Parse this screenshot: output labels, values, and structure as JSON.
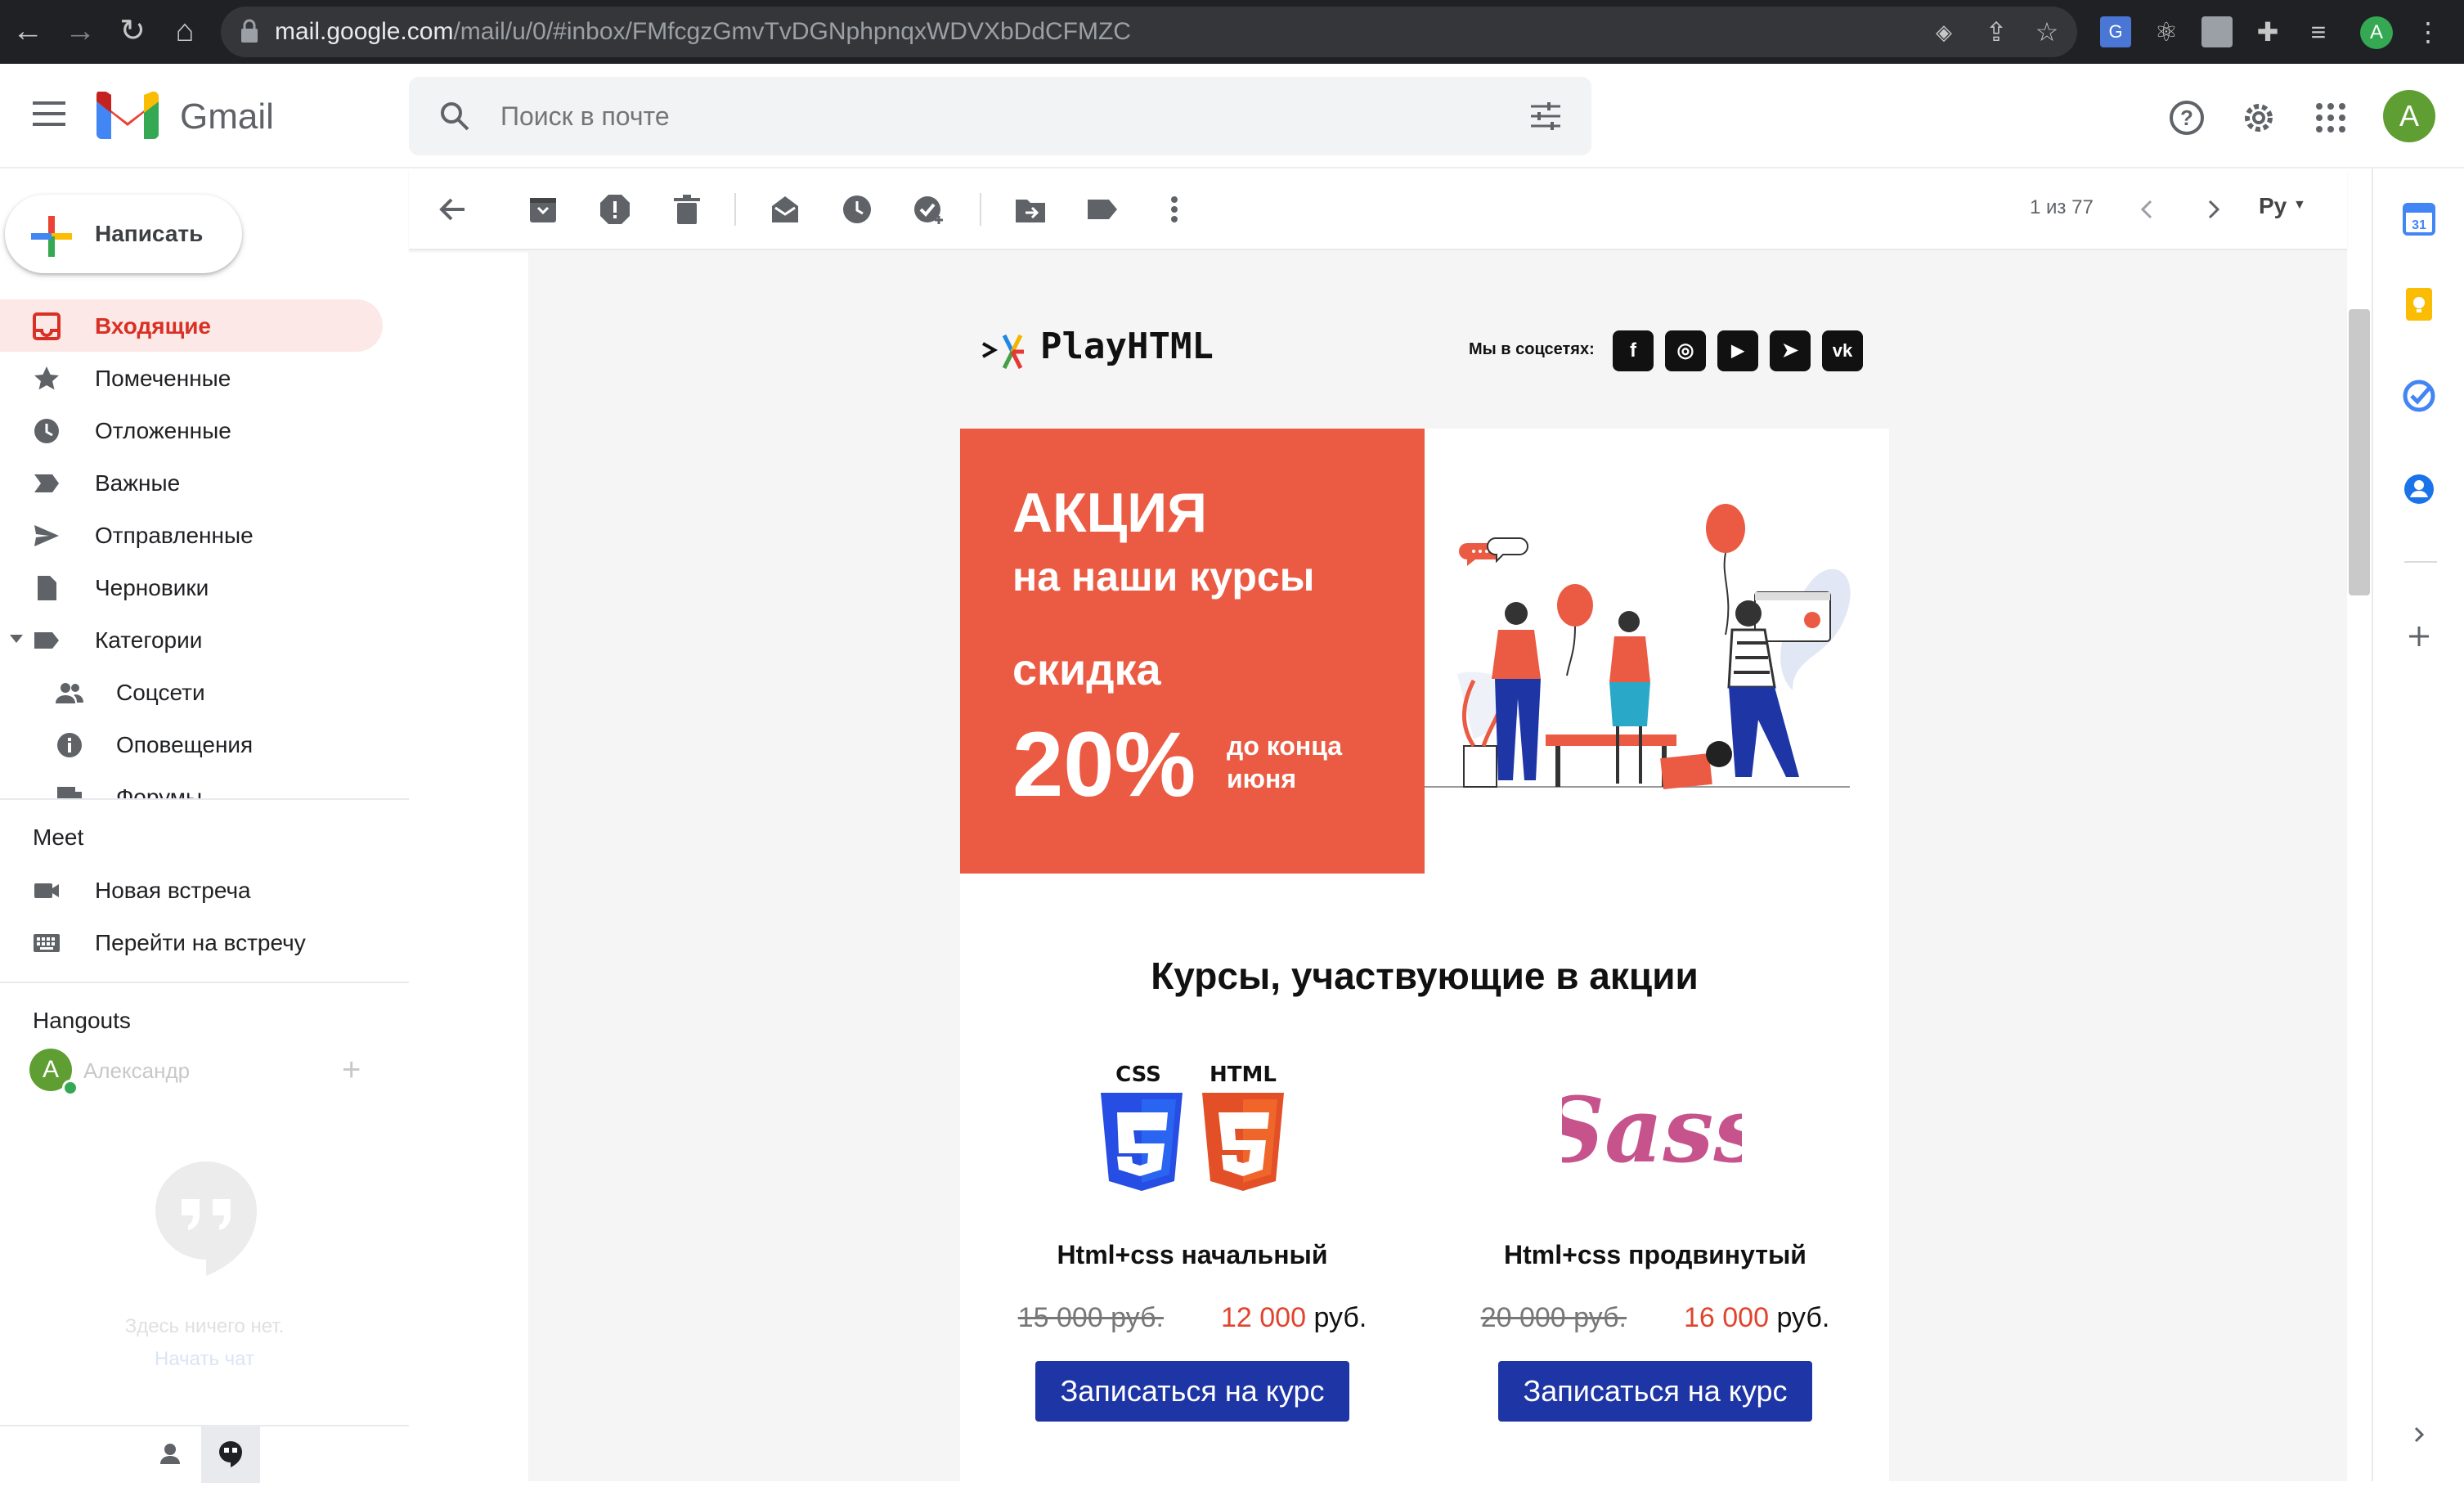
{
  "browser": {
    "url_host": "mail.google.com",
    "url_path": "/mail/u/0/#inbox/FMfcgzGmvTvDGNphpnqxWDVXbDdCFMZC",
    "profile_initial": "A"
  },
  "header": {
    "app_name": "Gmail",
    "search_placeholder": "Поиск в почте",
    "avatar_initial": "A"
  },
  "sidebar": {
    "compose_label": "Написать",
    "items": [
      {
        "label": "Входящие",
        "icon": "inbox-icon",
        "active": true
      },
      {
        "label": "Помеченные",
        "icon": "star-icon"
      },
      {
        "label": "Отложенные",
        "icon": "clock-icon"
      },
      {
        "label": "Важные",
        "icon": "important-icon"
      },
      {
        "label": "Отправленные",
        "icon": "send-icon"
      },
      {
        "label": "Черновики",
        "icon": "draft-icon"
      },
      {
        "label": "Категории",
        "icon": "label-icon"
      },
      {
        "label": "Соцсети",
        "icon": "people-icon"
      },
      {
        "label": "Оповещения",
        "icon": "info-icon"
      },
      {
        "label": "Форумы",
        "icon": "forum-icon"
      }
    ],
    "meet": {
      "title": "Meet",
      "new_meeting": "Новая встреча",
      "join_meeting": "Перейти на встречу"
    },
    "hangouts": {
      "title": "Hangouts",
      "user_initial": "A",
      "user_name": "Александр",
      "empty_text": "Здесь ничего нет.",
      "start_chat": "Начать чат"
    }
  },
  "toolbar": {
    "pager": "1 из 77",
    "language": "Ру"
  },
  "email": {
    "brand_name": "PlayHTML",
    "social_label": "Мы в соцсетях:",
    "social": [
      {
        "icon": "facebook-icon",
        "glyph": "f"
      },
      {
        "icon": "instagram-icon",
        "glyph": "◎"
      },
      {
        "icon": "youtube-icon",
        "glyph": "▶"
      },
      {
        "icon": "telegram-icon",
        "glyph": "➤"
      },
      {
        "icon": "vk-icon",
        "glyph": "vk"
      }
    ],
    "promo": {
      "line1": "АКЦИЯ",
      "line2": "на наши курсы",
      "line3": "скидка",
      "discount": "20%",
      "until": "до конца июня"
    },
    "courses_title": "Курсы, участвующие в акции",
    "css_label": "CSS",
    "html_label": "HTML",
    "sass_label": "Sass",
    "courses": [
      {
        "name": "Html+css начальный",
        "old_price": "15 000 руб.",
        "new_price": "12 000",
        "currency": " руб.",
        "button": "Записаться на курс"
      },
      {
        "name": "Html+css продвинутый",
        "old_price": "20 000 руб.",
        "new_price": "16 000",
        "currency": " руб.",
        "button": "Записаться на курс"
      }
    ]
  }
}
